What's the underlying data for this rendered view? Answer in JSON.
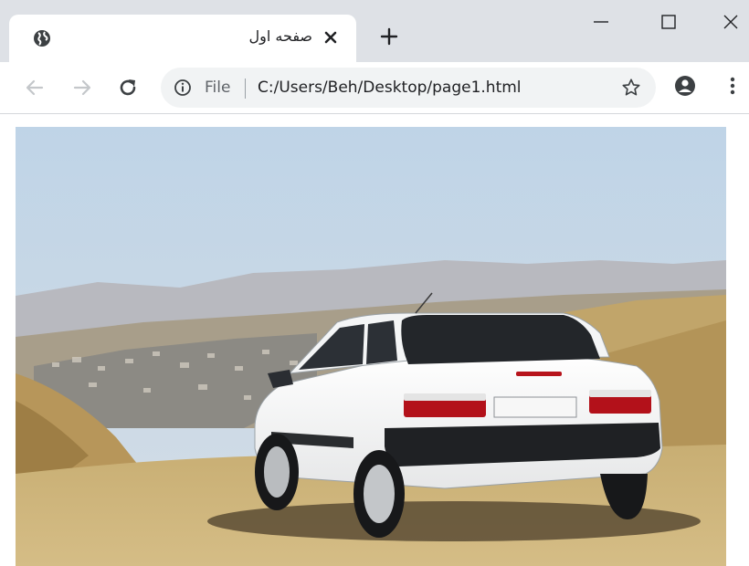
{
  "browser": {
    "tab": {
      "title": "صفحه اول",
      "favicon": "globe-icon"
    },
    "toolbar": {
      "back_icon": "arrow-left-icon",
      "forward_icon": "arrow-right-icon",
      "reload_icon": "reload-icon",
      "address": {
        "scheme_label": "File",
        "url": "C:/Users/Beh/Desktop/page1.html"
      }
    },
    "colors": {
      "tab_strip": "#dee1e6",
      "omnibox": "#f1f3f4",
      "icon_gray": "#5f6368"
    }
  },
  "page": {
    "image": {
      "subject": "white-hatchback-car-on-hill",
      "icon": "photo"
    }
  }
}
